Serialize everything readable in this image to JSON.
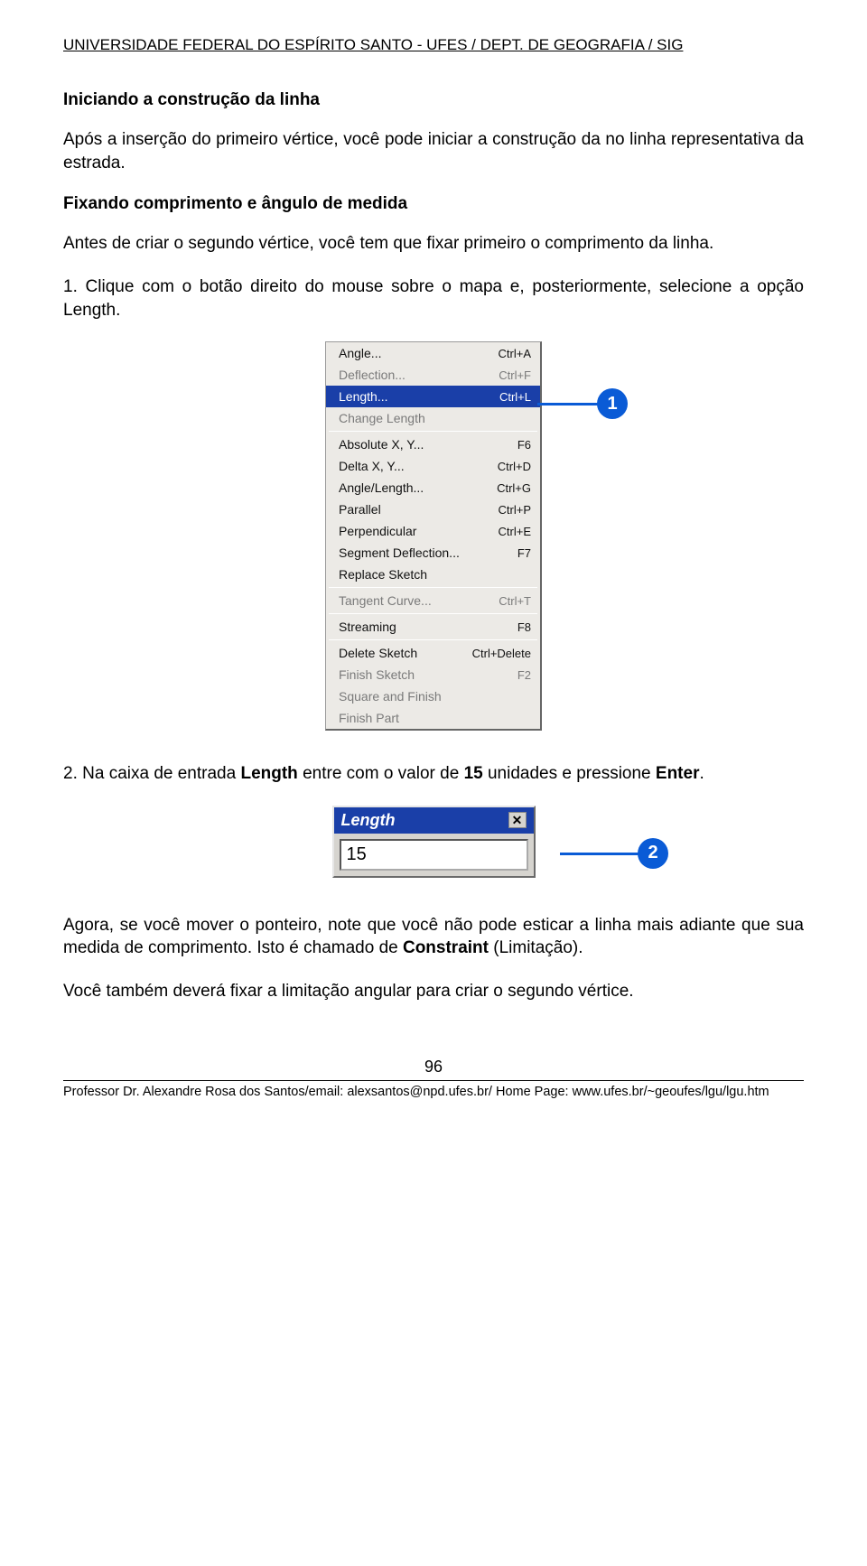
{
  "header": "UNIVERSIDADE FEDERAL DO ESPÍRITO SANTO - UFES / DEPT. DE GEOGRAFIA / SIG",
  "s1": {
    "title": "Iniciando a construção da linha",
    "p1": "Após a inserção do primeiro vértice, você pode iniciar a construção da no linha representativa da estrada."
  },
  "s2": {
    "title": "Fixando comprimento e ângulo de medida",
    "p1": "Antes de criar o segundo vértice, você tem que fixar primeiro o comprimento da linha.",
    "p2": "1. Clique com o botão direito do mouse sobre o mapa e, posteriormente, selecione a opção Length."
  },
  "menu": {
    "items": [
      {
        "label": "Angle...",
        "sc": "Ctrl+A",
        "enabled": true
      },
      {
        "label": "Deflection...",
        "sc": "Ctrl+F",
        "enabled": false
      },
      {
        "label": "Length...",
        "sc": "Ctrl+L",
        "enabled": true,
        "highlight": true
      },
      {
        "label": "Change Length",
        "sc": "",
        "enabled": false
      },
      {
        "sep": true
      },
      {
        "label": "Absolute X, Y...",
        "sc": "F6",
        "enabled": true
      },
      {
        "label": "Delta X, Y...",
        "sc": "Ctrl+D",
        "enabled": true
      },
      {
        "label": "Angle/Length...",
        "sc": "Ctrl+G",
        "enabled": true
      },
      {
        "label": "Parallel",
        "sc": "Ctrl+P",
        "enabled": true
      },
      {
        "label": "Perpendicular",
        "sc": "Ctrl+E",
        "enabled": true
      },
      {
        "label": "Segment Deflection...",
        "sc": "F7",
        "enabled": true
      },
      {
        "label": "Replace Sketch",
        "sc": "",
        "enabled": true
      },
      {
        "sep": true
      },
      {
        "label": "Tangent Curve...",
        "sc": "Ctrl+T",
        "enabled": false
      },
      {
        "sep": true
      },
      {
        "label": "Streaming",
        "sc": "F8",
        "enabled": true
      },
      {
        "sep": true
      },
      {
        "label": "Delete Sketch",
        "sc": "Ctrl+Delete",
        "enabled": true
      },
      {
        "label": "Finish Sketch",
        "sc": "F2",
        "enabled": false
      },
      {
        "label": "Square and Finish",
        "sc": "",
        "enabled": false
      },
      {
        "label": "Finish Part",
        "sc": "",
        "enabled": false
      }
    ],
    "callout": "1"
  },
  "s3": {
    "p1a": "2. Na caixa de entrada ",
    "p1b": "Length",
    "p1c": " entre com o valor de ",
    "p1d": "15",
    "p1e": " unidades e pressione ",
    "p1f": "Enter",
    "p1g": "."
  },
  "length_dialog": {
    "title": "Length",
    "close": "✕",
    "value": "15",
    "callout": "2"
  },
  "s4": {
    "p1a": "Agora, se você mover o ponteiro, note que você não pode esticar a linha mais adiante que sua medida de comprimento. Isto é chamado de ",
    "p1b": "Constraint",
    "p1c": " (Limitação).",
    "p2": "Você também deverá fixar a limitação angular para criar o segundo vértice."
  },
  "page_num": "96",
  "footer": "Professor Dr. Alexandre Rosa dos Santos/email: alexsantos@npd.ufes.br/ Home Page: www.ufes.br/~geoufes/lgu/lgu.htm"
}
